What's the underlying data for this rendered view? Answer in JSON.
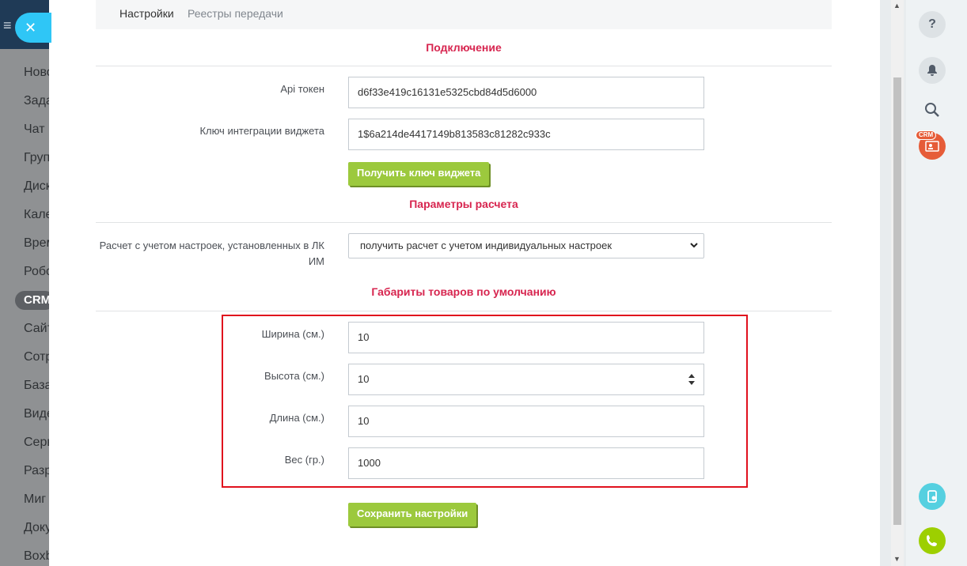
{
  "background": {
    "close_icon": "close-icon",
    "menu_items": [
      "Ново",
      "Зада",
      "Чат",
      "Груп",
      "Диск",
      "Кале",
      "Врем",
      "Робо",
      "CRM",
      "Сайт",
      "Сотр",
      "База",
      "Виде",
      "Серв",
      "Разр",
      "Миг",
      "Доку",
      "Boxb"
    ]
  },
  "tabs": [
    {
      "label": "Настройки",
      "active": true
    },
    {
      "label": "Реестры передачи",
      "active": false
    }
  ],
  "connection": {
    "title": "Подключение",
    "api_token_label": "Api токен",
    "api_token_value": "d6f33e419c16131e5325cbd84d5d6000",
    "widget_key_label": "Ключ интеграции виджета",
    "widget_key_value": "1$6a214de4417149b813583c81282c933c",
    "get_key_button": "Получить ключ виджета"
  },
  "calc": {
    "title": "Параметры расчета",
    "label": "Расчет с учетом настроек, установленных в ЛК ИМ",
    "selected_option": "получить расчет с учетом индивидуальных настроек"
  },
  "dimensions": {
    "title": "Габариты товаров по умолчанию",
    "width_label": "Ширина (см.)",
    "width_value": "10",
    "height_label": "Высота (см.)",
    "height_value": "10",
    "length_label": "Длина (см.)",
    "length_value": "10",
    "weight_label": "Вес (гр.)",
    "weight_value": "1000"
  },
  "save_button": "Сохранить настройки",
  "right_bar": {
    "help_icon": "help-icon",
    "bell_icon": "bell-icon",
    "search_icon": "search-icon",
    "crm_badge": "CRM",
    "teal_icon": "crm-form-icon",
    "phone_icon": "phone-icon"
  },
  "colors": {
    "accent_red": "#d7254f",
    "button_green": "#9cc93d",
    "highlight_box": "#e0111d"
  }
}
